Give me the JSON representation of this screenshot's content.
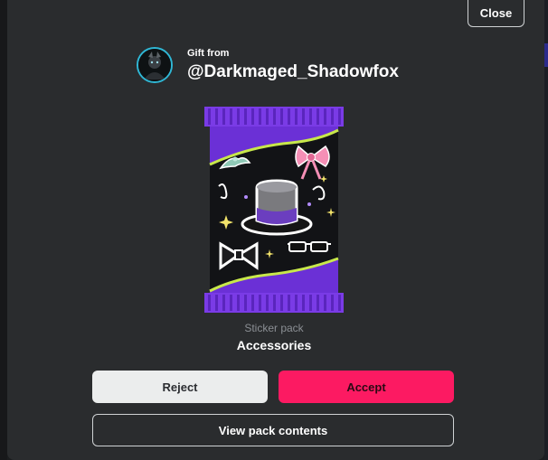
{
  "modal": {
    "close_label": "Close",
    "gift_from_label": "Gift from",
    "sender_username": "@Darkmaged_Shadowfox",
    "pack": {
      "type_label": "Sticker pack",
      "name": "Accessories"
    },
    "buttons": {
      "reject_label": "Reject",
      "accept_label": "Accept",
      "view_label": "View pack contents"
    }
  },
  "colors": {
    "modal_bg": "#2a2c2e",
    "accent_pink": "#fc1a62",
    "pack_purple": "#6b30d6",
    "avatar_ring": "#2fb7d5"
  },
  "icons": {
    "pack_art": [
      "top-hat-icon",
      "bow-icon",
      "bow-tie-icon",
      "sunglasses-icon",
      "tiara-icon",
      "sparkle-icon"
    ]
  }
}
